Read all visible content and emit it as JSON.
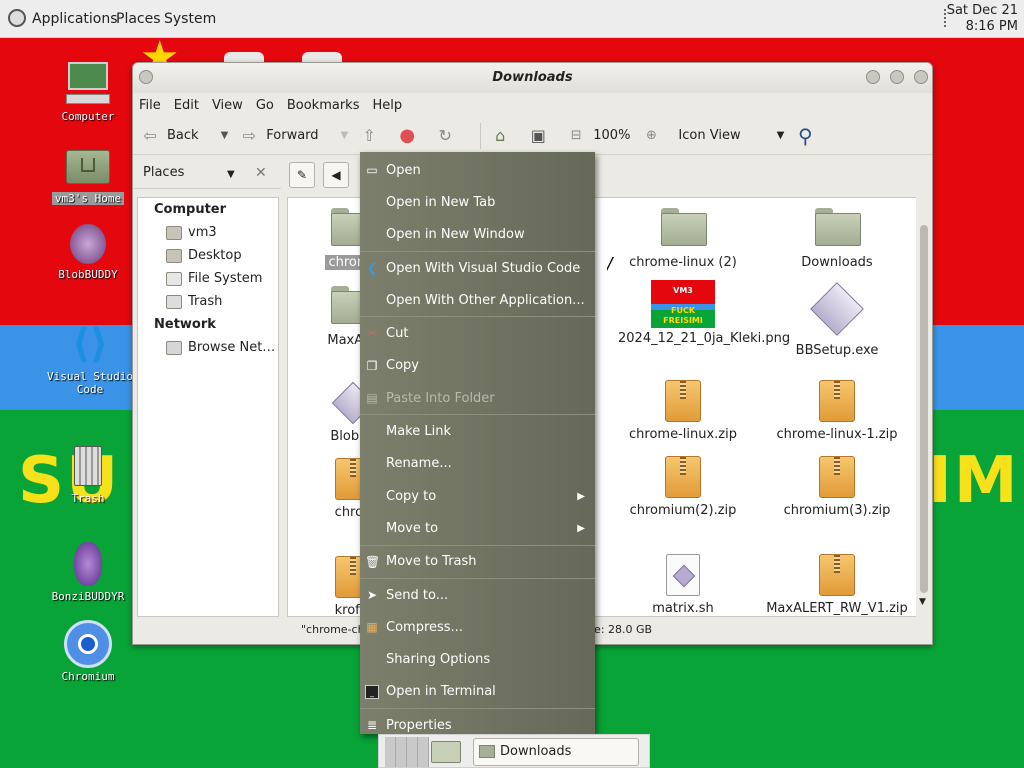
{
  "top_panel": {
    "menus": [
      "Applications",
      "Places",
      "System"
    ],
    "clock_date": "Sat Dec 21",
    "clock_time": "8:16 PM"
  },
  "wallpaper": {
    "text_left": "SU",
    "text_right": "IM"
  },
  "desktop_icons": [
    {
      "label": "Computer",
      "icon": "computer-icon"
    },
    {
      "label": "vm3's Home",
      "icon": "home-folder-icon"
    },
    {
      "label": "BlobBUDDY",
      "icon": "blobbuddy-icon"
    },
    {
      "label": "Visual Studio Code",
      "icon": "vscode-icon"
    },
    {
      "label": "Trash",
      "icon": "trash-icon"
    },
    {
      "label": "BonziBUDDYR",
      "icon": "bonzibuddy-icon"
    },
    {
      "label": "Chromium",
      "icon": "chromium-icon"
    }
  ],
  "window": {
    "title": "Downloads",
    "menubar": [
      "File",
      "Edit",
      "View",
      "Go",
      "Bookmarks",
      "Help"
    ],
    "toolbar": {
      "back": "Back",
      "forward": "Forward",
      "zoom": "100%",
      "view_mode": "Icon View"
    },
    "sidebar": {
      "header": "Places",
      "groups": [
        {
          "title": "Computer",
          "items": [
            "vm3",
            "Desktop",
            "File System",
            "Trash"
          ]
        },
        {
          "title": "Network",
          "items": [
            "Browse Net…"
          ]
        }
      ]
    },
    "files": [
      {
        "name": "chrome",
        "type": "folder",
        "selected": true
      },
      {
        "name": "chrome-linux (2)",
        "type": "folder"
      },
      {
        "name": "Downloads",
        "type": "folder"
      },
      {
        "name": "MaxALE",
        "type": "folder"
      },
      {
        "name": "2024_12_21_0ja_Kleki.png",
        "type": "image",
        "image_text_top": "VM3",
        "image_text_bottom": "FUCK FREISIMI"
      },
      {
        "name": "BBSetup.exe",
        "type": "exe"
      },
      {
        "name": "Blob14",
        "type": "exe"
      },
      {
        "name": "chrome-linux.zip",
        "type": "zip"
      },
      {
        "name": "chrome-linux-1.zip",
        "type": "zip"
      },
      {
        "name": "chron",
        "type": "zip"
      },
      {
        "name": "chromium(2).zip",
        "type": "zip"
      },
      {
        "name": "chromium(3).zip",
        "type": "zip"
      },
      {
        "name": "krofts",
        "type": "zip"
      },
      {
        "name": "matrix.sh",
        "type": "script"
      },
      {
        "name": "MaxALERT_RW_V1.zip",
        "type": "zip"
      }
    ],
    "status_left": "\"chrome-chr",
    "status_right": "ce: 28.0 GB"
  },
  "context_menu": {
    "items": [
      {
        "label": "Open",
        "icon": "open-icon"
      },
      {
        "label": "Open in New Tab"
      },
      {
        "label": "Open in New Window"
      },
      {
        "label": "Open With Visual Studio Code",
        "icon": "vscode-icon"
      },
      {
        "label": "Open With Other Application..."
      },
      {
        "label": "Cut",
        "icon": "scissors-icon"
      },
      {
        "label": "Copy",
        "icon": "copy-icon"
      },
      {
        "label": "Paste Into Folder",
        "icon": "paste-icon",
        "disabled": true
      },
      {
        "label": "Make Link"
      },
      {
        "label": "Rename..."
      },
      {
        "label": "Copy to",
        "submenu": true
      },
      {
        "label": "Move to",
        "submenu": true
      },
      {
        "label": "Move to Trash",
        "icon": "trash-icon"
      },
      {
        "label": "Send to...",
        "icon": "send-icon"
      },
      {
        "label": "Compress...",
        "icon": "archive-icon"
      },
      {
        "label": "Sharing Options"
      },
      {
        "label": "Open in Terminal",
        "icon": "terminal-icon"
      },
      {
        "label": "Properties",
        "icon": "properties-icon"
      }
    ]
  },
  "taskbar": {
    "task_label": "Downloads"
  }
}
